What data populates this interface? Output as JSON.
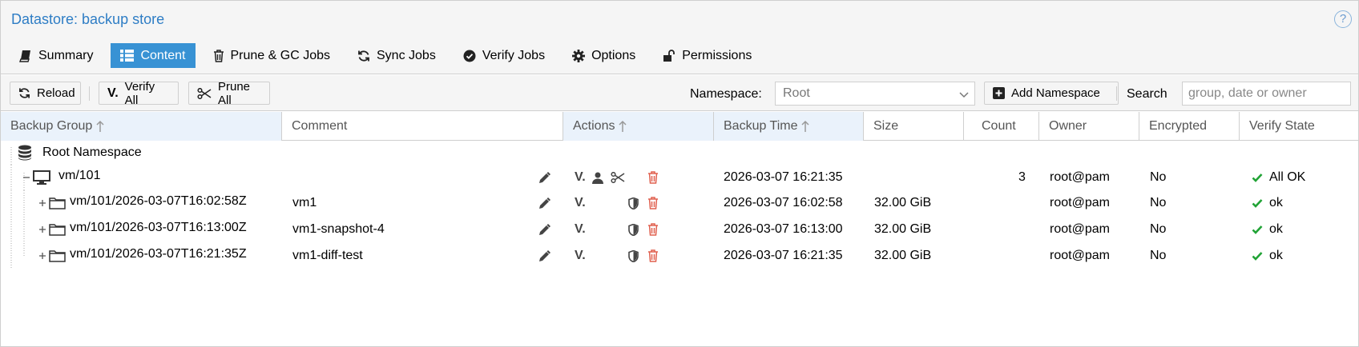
{
  "header": {
    "title": "Datastore: backup  store",
    "help_glyph": "?"
  },
  "tabs": [
    {
      "label": "Summary",
      "icon": "book-icon"
    },
    {
      "label": "Content",
      "icon": "grid-icon",
      "active": true
    },
    {
      "label": "Prune & GC Jobs",
      "icon": "trash-icon"
    },
    {
      "label": "Sync Jobs",
      "icon": "refresh-icon"
    },
    {
      "label": "Verify Jobs",
      "icon": "check-circle-icon"
    },
    {
      "label": "Options",
      "icon": "gear-icon"
    },
    {
      "label": "Permissions",
      "icon": "unlock-icon"
    }
  ],
  "toolbar": {
    "reload_label": "Reload",
    "verify_all_label": "Verify All",
    "prune_all_label": "Prune All",
    "namespace_label": "Namespace:",
    "namespace_value": "Root",
    "add_namespace_label": "Add Namespace",
    "search_label": "Search",
    "search_placeholder": "group, date or owner"
  },
  "columns": {
    "backup_group": "Backup Group",
    "comment": "Comment",
    "actions": "Actions",
    "backup_time": "Backup Time",
    "size": "Size",
    "count": "Count",
    "owner": "Owner",
    "encrypted": "Encrypted",
    "verify_state": "Verify State"
  },
  "tree": {
    "root_label": "Root Namespace",
    "group": {
      "label": "vm/101",
      "backup_time": "2026-03-07 16:21:35",
      "count": "3",
      "owner": "root@pam",
      "encrypted": "No",
      "verify_state": "All OK"
    },
    "snapshots": [
      {
        "label": "vm/101/2026-03-07T16:02:58Z",
        "comment": "vm1",
        "backup_time": "2026-03-07 16:02:58",
        "size": "32.00 GiB",
        "owner": "root@pam",
        "encrypted": "No",
        "verify_state": "ok"
      },
      {
        "label": "vm/101/2026-03-07T16:13:00Z",
        "comment": "vm1-snapshot-4",
        "backup_time": "2026-03-07 16:13:00",
        "size": "32.00 GiB",
        "owner": "root@pam",
        "encrypted": "No",
        "verify_state": "ok"
      },
      {
        "label": "vm/101/2026-03-07T16:21:35Z",
        "comment": "vm1-diff-test",
        "backup_time": "2026-03-07 16:21:35",
        "size": "32.00 GiB",
        "owner": "root@pam",
        "encrypted": "No",
        "verify_state": "ok"
      }
    ]
  },
  "colors": {
    "accent": "#3892d4",
    "title": "#2e7dc5",
    "ok": "#21a336",
    "delete": "#e0604f"
  }
}
